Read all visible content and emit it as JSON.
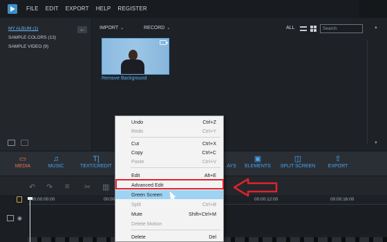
{
  "menubar": {
    "items": [
      "FILE",
      "EDIT",
      "EXPORT",
      "HELP",
      "REGISTER"
    ]
  },
  "left_panel": {
    "albums": [
      "MY ALBUM (1)",
      "SAMPLE COLORS (13)",
      "SAMPLE VIDEO (9)"
    ]
  },
  "toolbar": {
    "import_label": "IMPORT",
    "record_label": "RECORD",
    "filter_label": "ALL",
    "search_placeholder": "Search"
  },
  "media": {
    "clip_label": "Remove Background"
  },
  "tabs": [
    {
      "label": "MEDIA",
      "icon": "folder-icon",
      "active": true
    },
    {
      "label": "MUSIC",
      "icon": "music-note-icon"
    },
    {
      "label": "TEXT/CREDIT",
      "icon": "text-icon"
    },
    {
      "label": "AYS",
      "icon": "overlay-icon"
    },
    {
      "label": "ELEMENTS",
      "icon": "image-icon"
    },
    {
      "label": "SPLIT SCREEN",
      "icon": "split-screen-icon"
    },
    {
      "label": "EXPORT",
      "icon": "export-icon"
    }
  ],
  "timeline": {
    "times": [
      "00:00:00:00",
      "00:00:04:00",
      "00:00:12:00",
      "00:00:16:00"
    ]
  },
  "context_menu": {
    "items": [
      {
        "label": "Undo",
        "shortcut": "Ctrl+Z",
        "disabled": false
      },
      {
        "label": "Redo",
        "shortcut": "Ctrl+Y",
        "disabled": true
      },
      {
        "label": "Cut",
        "shortcut": "Ctrl+X",
        "disabled": false
      },
      {
        "label": "Copy",
        "shortcut": "Ctrl+C",
        "disabled": false
      },
      {
        "label": "Paste",
        "shortcut": "Ctrl+V",
        "disabled": true
      },
      {
        "label": "Edit",
        "shortcut": "Alt+E",
        "disabled": false
      },
      {
        "label": "Advanced Edit",
        "shortcut": "",
        "disabled": false
      },
      {
        "label": "Green Screen",
        "shortcut": "",
        "disabled": false,
        "highlighted": true
      },
      {
        "label": "Split",
        "shortcut": "Ctrl+B",
        "disabled": true
      },
      {
        "label": "Mute",
        "shortcut": "Shift+Ctrl+M",
        "disabled": false
      },
      {
        "label": "Delete Motion",
        "shortcut": "",
        "disabled": true
      },
      {
        "label": "Delete",
        "shortcut": "Del",
        "disabled": false
      }
    ]
  },
  "colors": {
    "accent_blue": "#4ba6ee",
    "active_orange": "#f2734a",
    "annotation_red": "#e0222a",
    "highlight": "#9fd3f3"
  }
}
